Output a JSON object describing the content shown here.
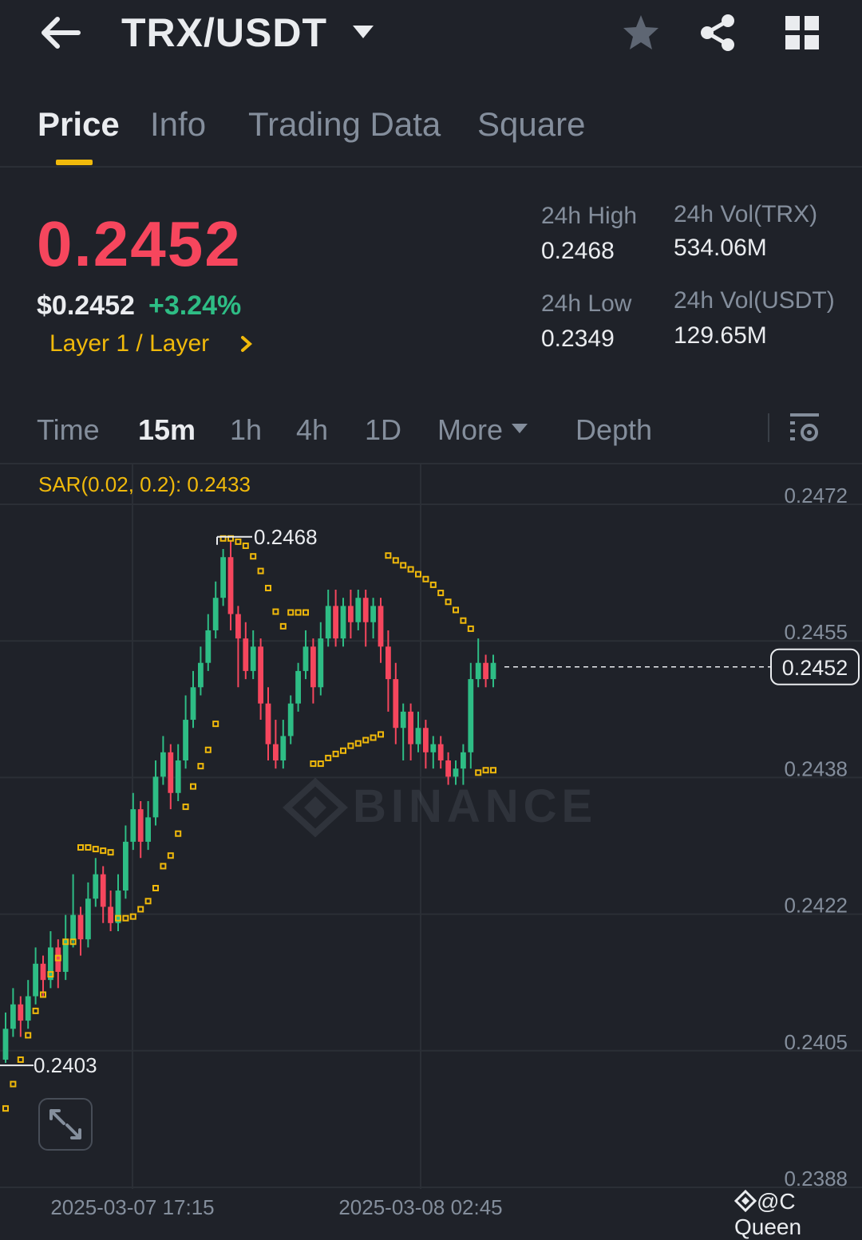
{
  "header": {
    "pair": "TRX/USDT",
    "icons": [
      "back-arrow-icon",
      "caret-down-icon",
      "star-icon",
      "share-icon",
      "grid-icon"
    ]
  },
  "tabs": [
    {
      "label": "Price",
      "active": true
    },
    {
      "label": "Info",
      "active": false
    },
    {
      "label": "Trading Data",
      "active": false
    },
    {
      "label": "Square",
      "active": false
    }
  ],
  "ticker": {
    "last_price": "0.2452",
    "usd_price": "$0.2452",
    "change": "+3.24%",
    "category": "Layer 1 / Layer",
    "high_label": "24h High",
    "high_value": "0.2468",
    "low_label": "24h Low",
    "low_value": "0.2349",
    "vol_trx_label": "24h Vol(TRX)",
    "vol_trx_value": "534.06M",
    "vol_usdt_label": "24h Vol(USDT)",
    "vol_usdt_value": "129.65M"
  },
  "intervals": {
    "time": "Time",
    "m15": "15m",
    "h1": "1h",
    "h4": "4h",
    "d1": "1D",
    "more": "More",
    "depth": "Depth",
    "active": "15m"
  },
  "indicator": {
    "label": "SAR(0.02, 0.2): 0.2433"
  },
  "colors": {
    "up": "#2ebd85",
    "down": "#f6465d",
    "sar": "#f0b90b",
    "accent": "#f0b90b",
    "bg": "#1f2229"
  },
  "credit": "@C Queen",
  "chart_data": {
    "type": "candlestick",
    "y_ticks": [
      "0.2472",
      "0.2455",
      "0.2438",
      "0.2422",
      "0.2405",
      "0.2388"
    ],
    "ylim": [
      0.2388,
      0.2472
    ],
    "x_ticks": [
      "2025-03-07 17:15",
      "2025-03-08 02:45"
    ],
    "current_price": "0.2452",
    "max_annotation": "0.2468",
    "min_annotation": "0.2403",
    "watermark": "BINANCE",
    "candles": [
      [
        0.24037,
        0.24075,
        0.24095,
        0.24033
      ],
      [
        0.24075,
        0.24105,
        0.24125,
        0.24065
      ],
      [
        0.24105,
        0.24085,
        0.24115,
        0.24065
      ],
      [
        0.24085,
        0.24115,
        0.24135,
        0.24075
      ],
      [
        0.24115,
        0.24155,
        0.24175,
        0.24105
      ],
      [
        0.24155,
        0.24135,
        0.24165,
        0.24115
      ],
      [
        0.24135,
        0.24175,
        0.24195,
        0.24125
      ],
      [
        0.24175,
        0.24145,
        0.24185,
        0.24125
      ],
      [
        0.24145,
        0.24185,
        0.24215,
        0.24135
      ],
      [
        0.24185,
        0.24215,
        0.24265,
        0.24175
      ],
      [
        0.24215,
        0.24185,
        0.24225,
        0.24165
      ],
      [
        0.24185,
        0.24235,
        0.24255,
        0.24175
      ],
      [
        0.24235,
        0.24265,
        0.24285,
        0.24225
      ],
      [
        0.24265,
        0.24225,
        0.24275,
        0.24205
      ],
      [
        0.24225,
        0.24205,
        0.24245,
        0.24195
      ],
      [
        0.24205,
        0.24245,
        0.24265,
        0.24195
      ],
      [
        0.24245,
        0.24305,
        0.24325,
        0.24235
      ],
      [
        0.24305,
        0.24345,
        0.24365,
        0.24295
      ],
      [
        0.24345,
        0.24305,
        0.24355,
        0.24285
      ],
      [
        0.24305,
        0.24335,
        0.24355,
        0.24295
      ],
      [
        0.24335,
        0.24385,
        0.24405,
        0.24325
      ],
      [
        0.24385,
        0.24415,
        0.24435,
        0.24375
      ],
      [
        0.24415,
        0.24365,
        0.24425,
        0.24345
      ],
      [
        0.24365,
        0.24405,
        0.24425,
        0.24355
      ],
      [
        0.24405,
        0.24455,
        0.24485,
        0.24395
      ],
      [
        0.24455,
        0.24495,
        0.24515,
        0.24445
      ],
      [
        0.24495,
        0.24525,
        0.24545,
        0.24485
      ],
      [
        0.24525,
        0.24565,
        0.24585,
        0.24515
      ],
      [
        0.24565,
        0.24605,
        0.24625,
        0.24555
      ],
      [
        0.24605,
        0.24655,
        0.24665,
        0.24595
      ],
      [
        0.24655,
        0.24585,
        0.24675,
        0.24565
      ],
      [
        0.24585,
        0.24555,
        0.24595,
        0.24495
      ],
      [
        0.24555,
        0.24515,
        0.24575,
        0.24505
      ],
      [
        0.24515,
        0.24545,
        0.24565,
        0.24505
      ],
      [
        0.24545,
        0.24475,
        0.24555,
        0.24455
      ],
      [
        0.24475,
        0.24425,
        0.24495,
        0.24405
      ],
      [
        0.24425,
        0.24405,
        0.24455,
        0.24395
      ],
      [
        0.24405,
        0.24435,
        0.24455,
        0.24395
      ],
      [
        0.24435,
        0.24475,
        0.24485,
        0.24425
      ],
      [
        0.24475,
        0.24515,
        0.24525,
        0.24465
      ],
      [
        0.24515,
        0.24545,
        0.24565,
        0.24505
      ],
      [
        0.24545,
        0.24495,
        0.24555,
        0.24475
      ],
      [
        0.24495,
        0.24555,
        0.24575,
        0.24485
      ],
      [
        0.24555,
        0.24595,
        0.24615,
        0.24545
      ],
      [
        0.24595,
        0.24555,
        0.24615,
        0.24545
      ],
      [
        0.24555,
        0.24595,
        0.24605,
        0.24545
      ],
      [
        0.24595,
        0.24575,
        0.24615,
        0.24555
      ],
      [
        0.24575,
        0.24605,
        0.24615,
        0.24565
      ],
      [
        0.24605,
        0.24575,
        0.24615,
        0.24545
      ],
      [
        0.24575,
        0.24595,
        0.24605,
        0.24555
      ],
      [
        0.24595,
        0.24545,
        0.24605,
        0.24525
      ],
      [
        0.24545,
        0.24505,
        0.24565,
        0.24465
      ],
      [
        0.24505,
        0.24445,
        0.24525,
        0.24425
      ],
      [
        0.24445,
        0.24465,
        0.24475,
        0.24405
      ],
      [
        0.24465,
        0.24425,
        0.24475,
        0.24405
      ],
      [
        0.24425,
        0.24445,
        0.24465,
        0.24415
      ],
      [
        0.24445,
        0.24415,
        0.24455,
        0.24395
      ],
      [
        0.24415,
        0.24425,
        0.24435,
        0.24395
      ],
      [
        0.24425,
        0.24405,
        0.24435,
        0.24395
      ],
      [
        0.24405,
        0.24385,
        0.24415,
        0.24375
      ],
      [
        0.24385,
        0.24395,
        0.24405,
        0.24375
      ],
      [
        0.24395,
        0.24415,
        0.24425,
        0.24375
      ],
      [
        0.24415,
        0.24505,
        0.24525,
        0.24395
      ],
      [
        0.24505,
        0.24525,
        0.24555,
        0.24495
      ],
      [
        0.24525,
        0.24505,
        0.24535,
        0.24495
      ],
      [
        0.24505,
        0.24525,
        0.24535,
        0.24495
      ]
    ],
    "sar": [
      [
        0,
        0.23977
      ],
      [
        1,
        0.24007
      ],
      [
        2,
        0.24037
      ],
      [
        3,
        0.24067
      ],
      [
        4,
        0.24097
      ],
      [
        5,
        0.24117
      ],
      [
        6,
        0.24142
      ],
      [
        7,
        0.24162
      ],
      [
        8,
        0.24182
      ],
      [
        9,
        0.24182
      ],
      [
        10,
        0.24298
      ],
      [
        11,
        0.24298
      ],
      [
        12,
        0.24296
      ],
      [
        13,
        0.24294
      ],
      [
        14,
        0.24292
      ],
      [
        15,
        0.24211
      ],
      [
        16,
        0.24211
      ],
      [
        17,
        0.24213
      ],
      [
        18,
        0.24222
      ],
      [
        19,
        0.24232
      ],
      [
        20,
        0.24248
      ],
      [
        21,
        0.24275
      ],
      [
        22,
        0.24288
      ],
      [
        23,
        0.24315
      ],
      [
        24,
        0.24348
      ],
      [
        25,
        0.24373
      ],
      [
        26,
        0.24398
      ],
      [
        27,
        0.24418
      ],
      [
        28,
        0.2445
      ],
      [
        29,
        0.24678
      ],
      [
        30,
        0.24678
      ],
      [
        31,
        0.24674
      ],
      [
        32,
        0.24669
      ],
      [
        33,
        0.24656
      ],
      [
        34,
        0.24638
      ],
      [
        35,
        0.24617
      ],
      [
        36,
        0.24588
      ],
      [
        37,
        0.2457
      ],
      [
        38,
        0.24587
      ],
      [
        39,
        0.24587
      ],
      [
        40,
        0.24587
      ],
      [
        41,
        0.24401
      ],
      [
        42,
        0.24401
      ],
      [
        43,
        0.24408
      ],
      [
        44,
        0.24413
      ],
      [
        45,
        0.24417
      ],
      [
        46,
        0.24423
      ],
      [
        47,
        0.24426
      ],
      [
        48,
        0.2443
      ],
      [
        49,
        0.24433
      ],
      [
        50,
        0.24437
      ],
      [
        51,
        0.24657
      ],
      [
        52,
        0.24651
      ],
      [
        53,
        0.24645
      ],
      [
        54,
        0.2464
      ],
      [
        55,
        0.24634
      ],
      [
        56,
        0.24628
      ],
      [
        57,
        0.24621
      ],
      [
        58,
        0.24611
      ],
      [
        59,
        0.246
      ],
      [
        60,
        0.2459
      ],
      [
        61,
        0.24577
      ],
      [
        62,
        0.24567
      ],
      [
        63,
        0.2439
      ],
      [
        64,
        0.24393
      ],
      [
        65,
        0.24393
      ]
    ]
  }
}
